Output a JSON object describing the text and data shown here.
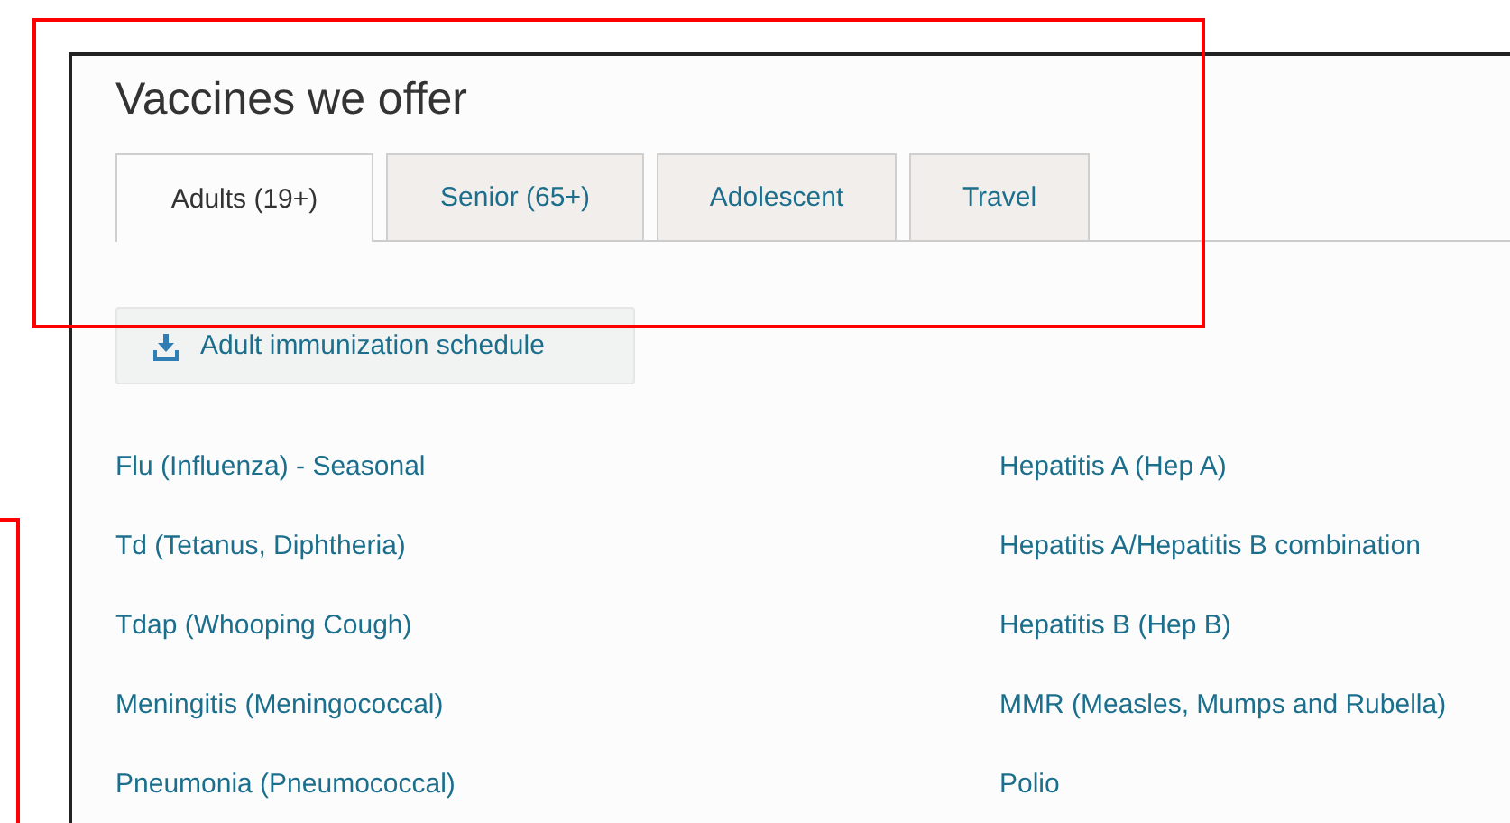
{
  "heading": "Vaccines we offer",
  "tabs": [
    {
      "label": "Adults (19+)",
      "selected": true
    },
    {
      "label": "Senior (65+)",
      "selected": false
    },
    {
      "label": "Adolescent",
      "selected": false
    },
    {
      "label": "Travel",
      "selected": false
    }
  ],
  "download_button": {
    "label": "Adult immunization schedule"
  },
  "vaccine_columns": [
    [
      "Flu (Influenza) - Seasonal",
      "Td (Tetanus, Diphtheria)",
      "Tdap (Whooping Cough)",
      "Meningitis (Meningococcal)",
      "Pneumonia (Pneumococcal)"
    ],
    [
      "Hepatitis A (Hep A)",
      "Hepatitis A/Hepatitis B combination",
      "Hepatitis B (Hep B)",
      "MMR (Measles, Mumps and Rubella)",
      "Polio"
    ]
  ]
}
